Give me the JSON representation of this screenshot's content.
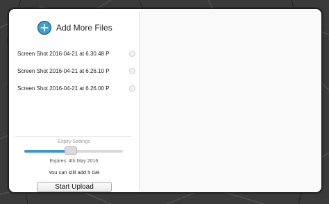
{
  "add_files": {
    "label": "Add More Files",
    "icon": "plus-circle-icon",
    "accent": "#2fa3de"
  },
  "files": [
    {
      "name": "Screen Shot 2016-04-21 at 6.30.48 P"
    },
    {
      "name": "Screen Shot 2016-04-21 at 6.26.10 P"
    },
    {
      "name": "Screen Shot 2016-04-21 at 6.26.00 P"
    }
  ],
  "expiry": {
    "title": "Expiry Settings",
    "level": 0.47,
    "expires_text": "Expires: 4th May 2016",
    "fill_color": "#3d95d5"
  },
  "capacity_text": "You can still add 5 GB",
  "upload_button": "Start Upload"
}
